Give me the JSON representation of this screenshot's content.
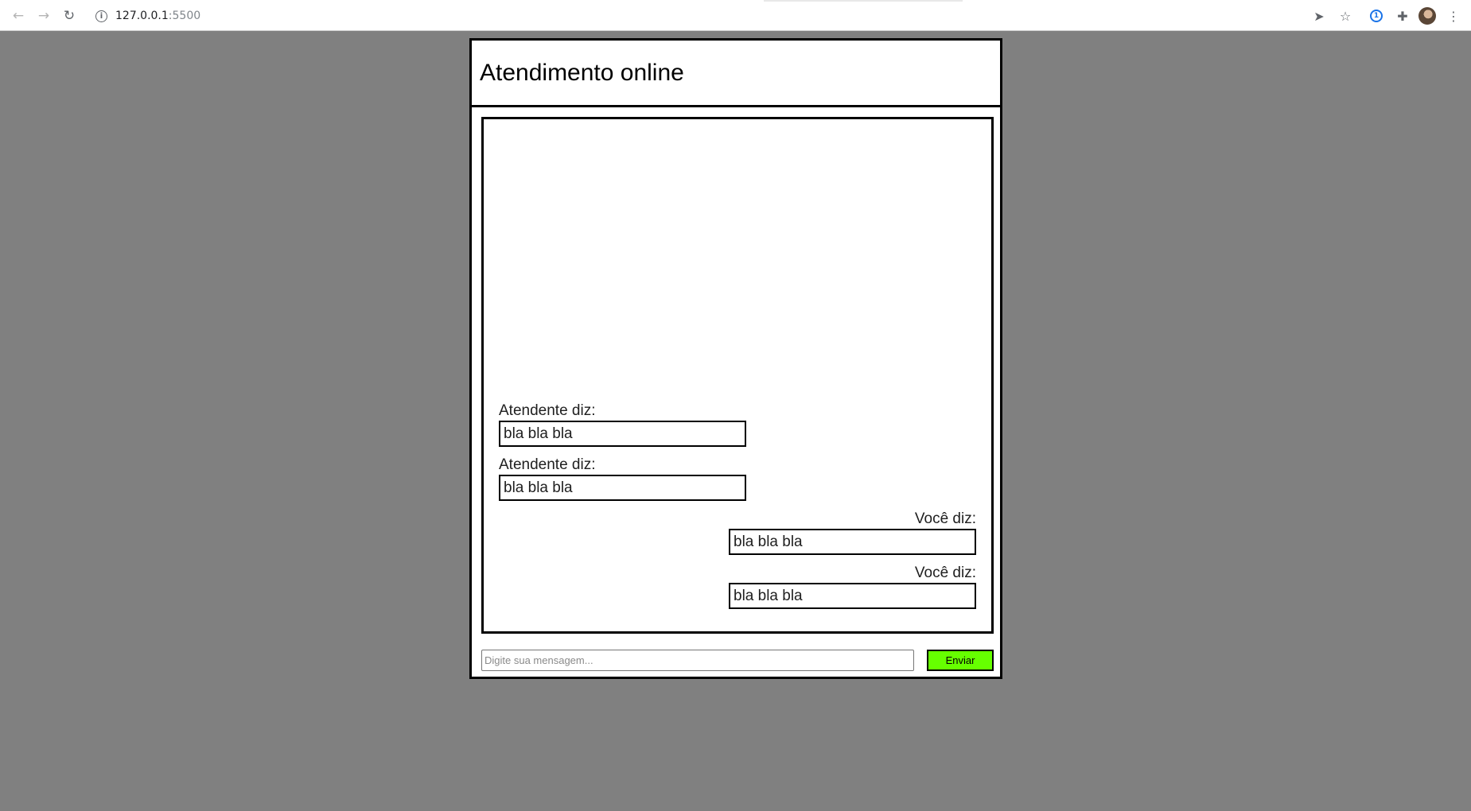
{
  "browser": {
    "url_host": "127.0.0.1",
    "url_port": ":5500",
    "icons": {
      "back": "arrow-left-icon",
      "forward": "arrow-right-icon",
      "reload": "reload-icon",
      "info": "info-icon",
      "send": "send-icon",
      "bookmark": "star-icon",
      "password": "password-manager-icon",
      "extensions": "puzzle-icon",
      "profile": "avatar",
      "menu": "kebab-menu-icon"
    }
  },
  "chat": {
    "title": "Atendimento online",
    "messages": [
      {
        "sender": "Atendente diz:",
        "text": "bla bla bla",
        "side": "left"
      },
      {
        "sender": "Atendente diz:",
        "text": "bla bla bla",
        "side": "left"
      },
      {
        "sender": "Você diz:",
        "text": "bla bla bla",
        "side": "right"
      },
      {
        "sender": "Você diz:",
        "text": "bla bla bla",
        "side": "right"
      }
    ],
    "input_placeholder": "Digite sua mensagem...",
    "input_value": "",
    "send_label": "Enviar"
  },
  "colors": {
    "page_background": "#808080",
    "send_button": "#66ff00",
    "border": "#000000"
  }
}
